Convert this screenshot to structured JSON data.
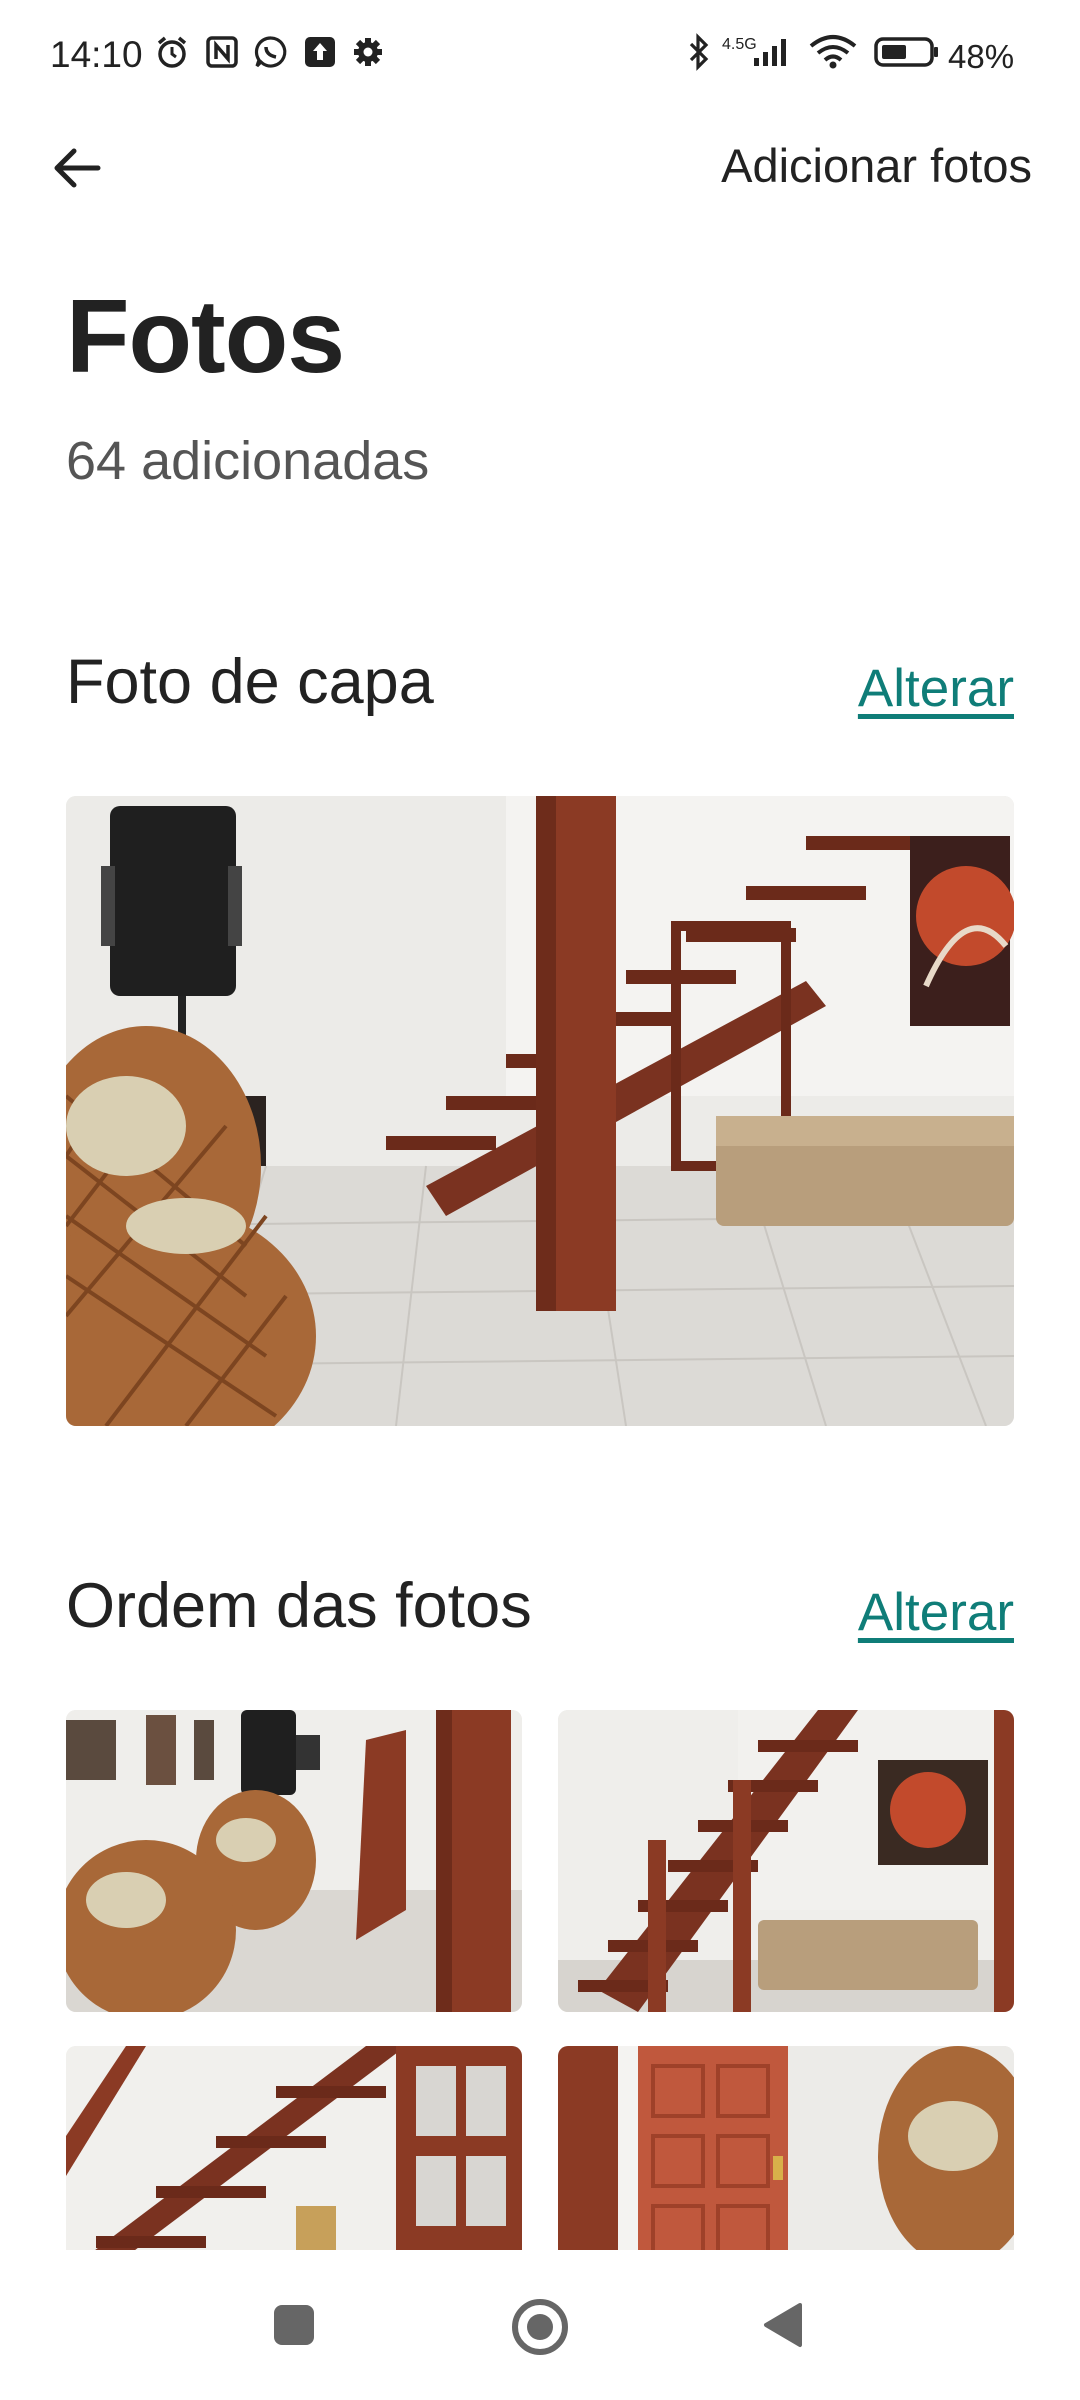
{
  "status_bar": {
    "time": "14:10",
    "network": "4.5G",
    "battery": "48%"
  },
  "header": {
    "add_photos_label": "Adicionar fotos"
  },
  "page": {
    "title": "Fotos",
    "subtitle": "64 adicionadas"
  },
  "cover_section": {
    "title": "Foto de capa",
    "action": "Alterar"
  },
  "order_section": {
    "title": "Ordem das fotos",
    "action": "Alterar"
  },
  "icons": {
    "back": "arrow-left-icon",
    "nav_home": "circle-home-icon",
    "nav_recent": "square-recent-icon",
    "nav_back": "triangle-back-icon"
  },
  "colors": {
    "link": "#0f7d78",
    "wood": "#8b3a24",
    "text": "#222222"
  }
}
